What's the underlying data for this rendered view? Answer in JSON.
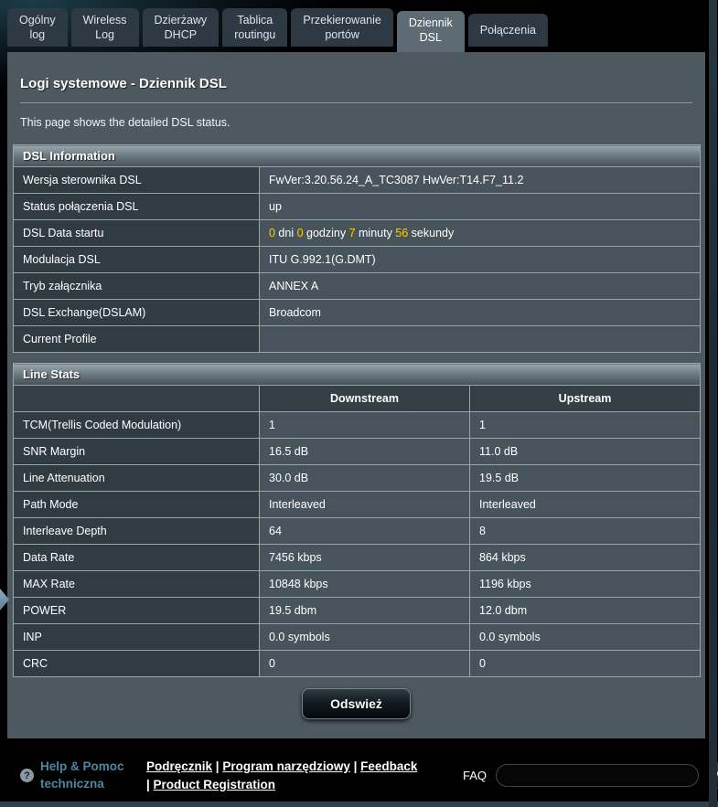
{
  "tabs": [
    {
      "label": "Ogólny\nlog",
      "active": false
    },
    {
      "label": "Wireless\nLog",
      "active": false
    },
    {
      "label": "Dzierżawy\nDHCP",
      "active": false
    },
    {
      "label": "Tablica\nroutingu",
      "active": false
    },
    {
      "label": "Przekierowanie\nportów",
      "active": false
    },
    {
      "label": "Dziennik\nDSL",
      "active": true
    },
    {
      "label": "Połączenia",
      "active": false
    }
  ],
  "page": {
    "title": "Logi systemowe - Dziennik DSL",
    "description": "This page shows the detailed DSL status."
  },
  "dsl_information": {
    "header": "DSL Information",
    "rows": [
      {
        "label": "Wersja sterownika DSL",
        "value": "FwVer:3.20.56.24_A_TC3087 HwVer:T14.F7_11.2"
      },
      {
        "label": "Status połączenia DSL",
        "value": "up"
      },
      {
        "label": "DSL Data startu",
        "parts": [
          {
            "text": "0",
            "highlight": true
          },
          {
            "text": " dni ",
            "highlight": false
          },
          {
            "text": "0",
            "highlight": true
          },
          {
            "text": " godziny ",
            "highlight": false
          },
          {
            "text": "7",
            "highlight": true
          },
          {
            "text": " minuty ",
            "highlight": false
          },
          {
            "text": "56",
            "highlight": true
          },
          {
            "text": " sekundy",
            "highlight": false
          }
        ]
      },
      {
        "label": "Modulacja DSL",
        "value": "ITU G.992.1(G.DMT)"
      },
      {
        "label": "Tryb załącznika",
        "value": "ANNEX A"
      },
      {
        "label": "DSL Exchange(DSLAM)",
        "value": "Broadcom"
      },
      {
        "label": "Current Profile",
        "value": ""
      }
    ]
  },
  "line_stats": {
    "header": "Line Stats",
    "columns": [
      "Downstream",
      "Upstream"
    ],
    "rows": [
      {
        "label": "TCM(Trellis Coded Modulation)",
        "downstream": "1",
        "upstream": "1"
      },
      {
        "label": "SNR Margin",
        "downstream": "16.5 dB",
        "upstream": "11.0 dB"
      },
      {
        "label": "Line Attenuation",
        "downstream": "30.0 dB",
        "upstream": "19.5 dB"
      },
      {
        "label": "Path Mode",
        "downstream": "Interleaved",
        "upstream": "Interleaved"
      },
      {
        "label": "Interleave Depth",
        "downstream": "64",
        "upstream": "8"
      },
      {
        "label": "Data Rate",
        "downstream": "7456 kbps",
        "upstream": "864 kbps"
      },
      {
        "label": "MAX Rate",
        "downstream": "10848 kbps",
        "upstream": "1196 kbps"
      },
      {
        "label": "POWER",
        "downstream": "19.5 dbm",
        "upstream": "12.0 dbm"
      },
      {
        "label": "INP",
        "downstream": "0.0 symbols",
        "upstream": "0.0 symbols"
      },
      {
        "label": "CRC",
        "downstream": "0",
        "upstream": "0"
      }
    ]
  },
  "refresh_button": "Odswież",
  "footer": {
    "help_icon": "?",
    "help_label": "Help & Pomoc techniczna",
    "links": [
      "Podręcznik",
      "Program narzędziowy",
      "Feedback",
      "Product Registration"
    ],
    "link_separator": " | ",
    "faq_label": "FAQ",
    "faq_value": ""
  },
  "colors": {
    "highlight_number": "#ffcc00",
    "help_link_blue": "#4d87a0",
    "panel_gray": "#4d585f",
    "tab_inactive": "#2d3a43",
    "tab_active": "#5d6b74",
    "cell_label": "#313c42",
    "cell_value": "#47545b"
  }
}
